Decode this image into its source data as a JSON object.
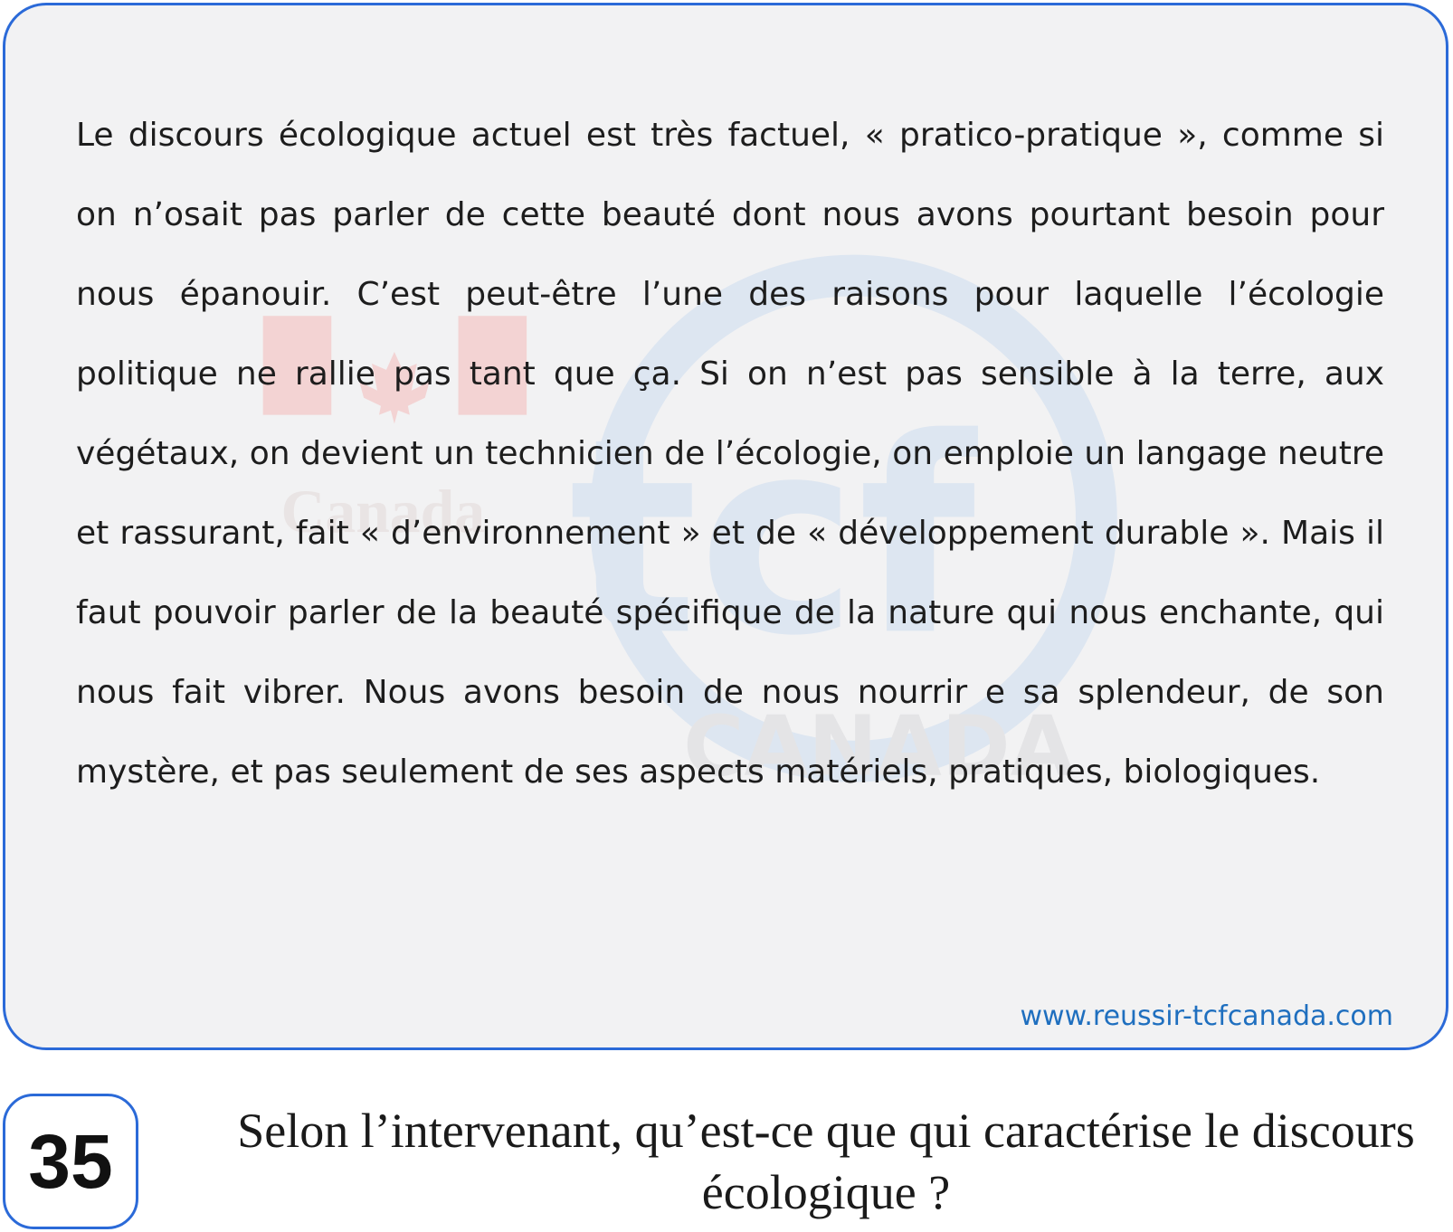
{
  "passage": {
    "text": "Le discours écologique actuel est très factuel, « pratico-pratique », comme si on n’osait pas parler de cette beauté dont nous avons pourtant besoin pour nous épanouir. C’est peut-être l’une des raisons pour laquelle l’écologie politique ne rallie pas tant que ça. Si on n’est pas sensible à la terre, aux végétaux, on devient un technicien de l’écologie, on emploie un langage neutre et rassurant, fait « d’environnement » et de « développement durable ». Mais il faut pouvoir parler de la beauté spécifique de la nature qui nous enchante, qui nous fait vibrer. Nous avons besoin de nous nourrir e sa splendeur, de son mystère, et pas seulement de ses aspects matériels, pratiques, biologiques.",
    "source_url": "www.reussir-tcfcanada.com",
    "watermark": {
      "logo_text": "tcf",
      "country_text": "CANADA",
      "wordmark": "Canada"
    }
  },
  "question": {
    "number": "35",
    "text": "Selon l’intervenant, qu’est-ce que qui caractérise le discours écologique ?"
  },
  "colors": {
    "card_border": "#2b6ad8",
    "card_background": "#f2f2f3",
    "url": "#1f6fbf",
    "watermark_red": "#f3d3d3",
    "watermark_blue": "#dde6f1"
  }
}
